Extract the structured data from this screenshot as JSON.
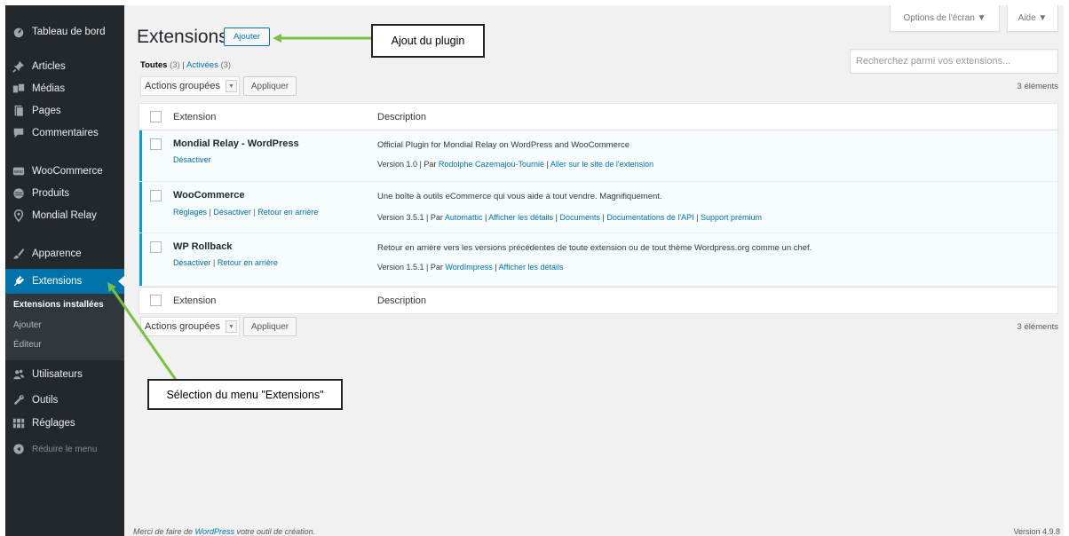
{
  "sidebar": {
    "items": [
      {
        "label": "Tableau de bord",
        "icon": "dashboard-icon"
      },
      {
        "label": "Articles",
        "icon": "pushpin-icon"
      },
      {
        "label": "Médias",
        "icon": "media-icon"
      },
      {
        "label": "Pages",
        "icon": "pages-icon"
      },
      {
        "label": "Commentaires",
        "icon": "comment-icon"
      },
      {
        "label": "WooCommerce",
        "icon": "woocommerce-icon"
      },
      {
        "label": "Produits",
        "icon": "archive-icon"
      },
      {
        "label": "Mondial Relay",
        "icon": "location-icon"
      },
      {
        "label": "Apparence",
        "icon": "paintbrush-icon"
      },
      {
        "label": "Extensions",
        "icon": "plugin-icon"
      },
      {
        "label": "Utilisateurs",
        "icon": "users-icon"
      },
      {
        "label": "Outils",
        "icon": "wrench-icon"
      },
      {
        "label": "Réglages",
        "icon": "settings-icon"
      },
      {
        "label": "Réduire le menu",
        "icon": "collapse-icon"
      }
    ],
    "submenu": [
      "Extensions installées",
      "Ajouter",
      "Éditeur"
    ]
  },
  "screen_options_label": "Options de l'écran ▼",
  "help_label": "Aide ▼",
  "header": {
    "title": "Extensions",
    "add_label": "Ajouter"
  },
  "filters": {
    "all": "Toutes",
    "all_count": "(3)",
    "separator": " | ",
    "active": "Activées",
    "active_count": "(3)"
  },
  "search": {
    "placeholder": "Recherchez parmi vos extensions..."
  },
  "bulk": {
    "select_label": "Actions groupées",
    "apply_label": "Appliquer",
    "count": "3 éléments"
  },
  "table": {
    "columns": [
      "Extension",
      "Description"
    ],
    "plugins": [
      {
        "name": "Mondial Relay - WordPress",
        "actions": [
          "Désactiver"
        ],
        "description": "Official Plugin for Mondial Relay on WordPress and WooCommerce",
        "version": "Version 1.0",
        "by": "Par",
        "author": "Rodolphe Cazemajou-Tournié",
        "links": [
          "Aller sur le site de l'extension"
        ]
      },
      {
        "name": "WooCommerce",
        "actions": [
          "Réglages",
          "Désactiver",
          "Retour en arrière"
        ],
        "description": "Une boîte à outils eCommerce qui vous aide à tout vendre. Magnifiquement.",
        "version": "Version 3.5.1",
        "by": "Par",
        "author": "Automattic",
        "links": [
          "Afficher les détails",
          "Documents",
          "Documentations de l'API",
          "Support premium"
        ]
      },
      {
        "name": "WP Rollback",
        "actions": [
          "Désactiver",
          "Retour en arrière"
        ],
        "description": "Retour en arrière vers les versions précédentes de toute extension ou de tout thème Wordpress.org comme un chef.",
        "version": "Version 1.5.1",
        "by": "Par",
        "author": "WordImpress",
        "links": [
          "Afficher les détails"
        ]
      }
    ]
  },
  "footer": {
    "thanks_prefix": "Merci de faire de ",
    "thanks_link": "WordPress",
    "thanks_suffix": " votre outil de création.",
    "version": "Version 4.9.8"
  },
  "annotations": {
    "add_plugin": "Ajout du plugin",
    "select_menu": "Sélection du menu \"Extensions\""
  },
  "colors": {
    "sidebar_bg": "#23282d",
    "active_bg": "#0073aa",
    "link": "#0073aa",
    "arrow": "#7ac143",
    "active_plugin_border": "#00a0d2"
  }
}
